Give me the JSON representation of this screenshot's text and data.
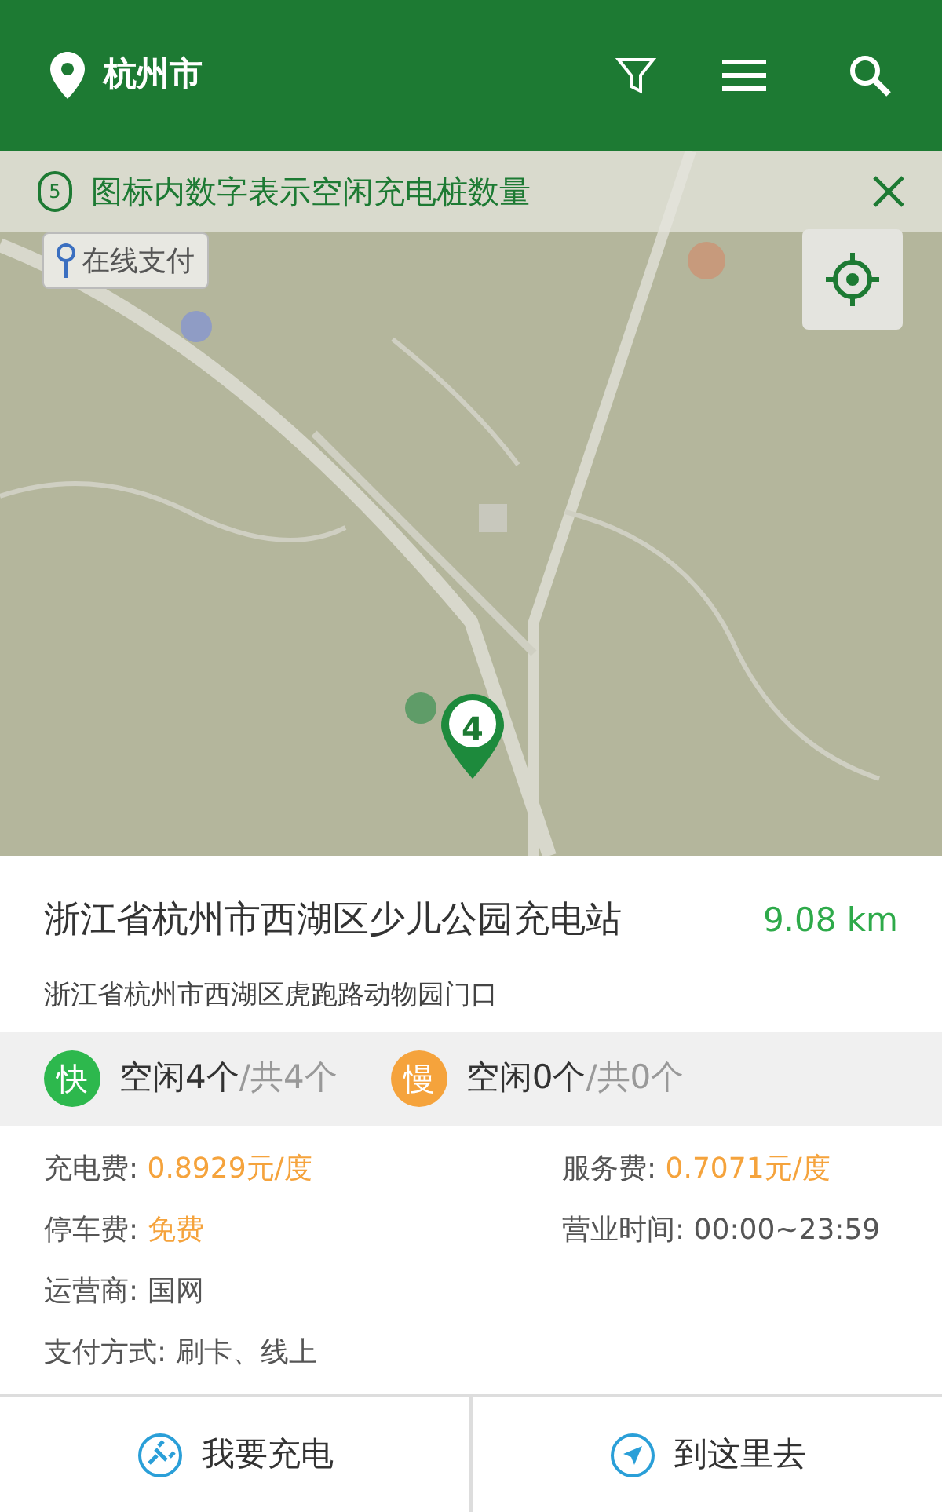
{
  "header": {
    "city": "杭州市"
  },
  "notice": {
    "badge": "5",
    "text": "图标内数字表示空闲充电桩数量"
  },
  "map": {
    "pay_button": "在线支付",
    "marker": "4"
  },
  "station": {
    "name": "浙江省杭州市西湖区少儿公园充电站",
    "distance": "9.08 km",
    "address": "浙江省杭州市西湖区虎跑路动物园门口"
  },
  "chargers": [
    {
      "badge": "快",
      "free": "空闲4个",
      "total": "/共4个",
      "color": "#2db84d"
    },
    {
      "badge": "慢",
      "free": "空闲0个",
      "total": "/共0个",
      "color": "#f5a33c"
    }
  ],
  "details": [
    [
      {
        "label": "充电费: ",
        "value": "0.8929元/度",
        "highlight": true
      },
      {
        "label": "服务费: ",
        "value": "0.7071元/度",
        "highlight": true
      }
    ],
    [
      {
        "label": "停车费: ",
        "value": "免费",
        "highlight": true
      },
      {
        "label": "营业时间: ",
        "value": "00:00~23:59",
        "highlight": false
      }
    ],
    [
      {
        "label": "运营商: ",
        "value": "国网",
        "highlight": false
      }
    ],
    [
      {
        "label": "支付方式: ",
        "value": "刷卡、线上",
        "highlight": false
      }
    ]
  ],
  "actions": [
    {
      "label": "我要充电",
      "kind": "charge"
    },
    {
      "label": "到这里去",
      "kind": "navigate"
    }
  ]
}
